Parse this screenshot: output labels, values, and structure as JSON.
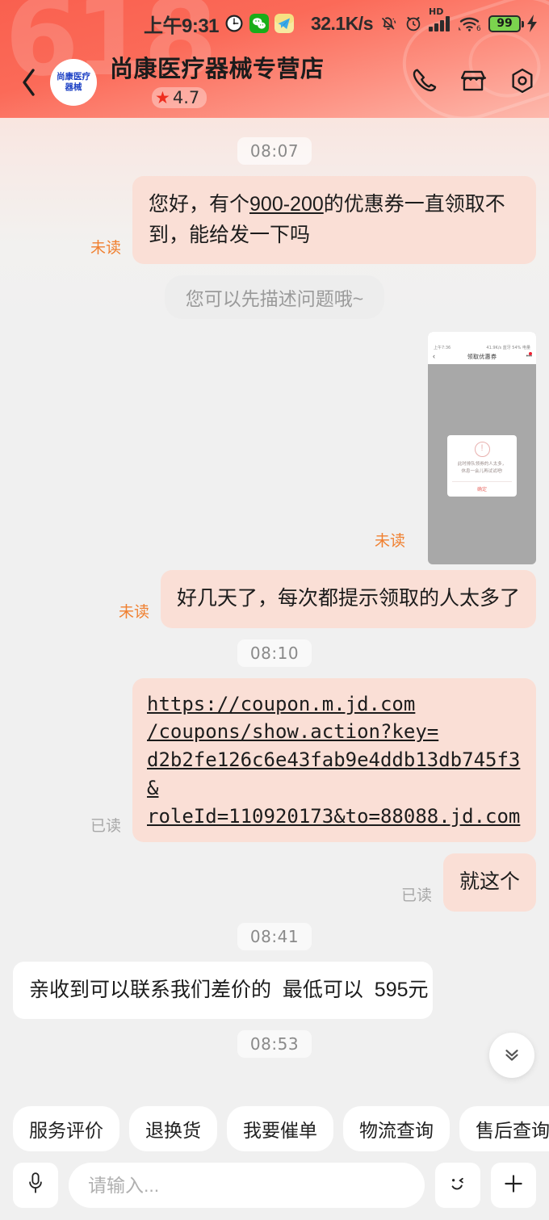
{
  "status_bar": {
    "time": "上午9:31",
    "network_speed": "32.1K/s",
    "battery_level": "99",
    "hd_label": "HD",
    "wifi_generation": "6",
    "icons": [
      "clock-icon",
      "wechat-icon",
      "telegram-icon",
      "mute-bell-icon",
      "alarm-clock-icon",
      "hd-signal-icon",
      "wifi-icon",
      "battery-icon",
      "charging-bolt-icon"
    ]
  },
  "header": {
    "watermark": "618",
    "back_icon": "back-chevron-icon",
    "avatar_line1": "尚康医疗",
    "avatar_line2": "器械",
    "store_name": "尚康医疗器械专营店",
    "rating": "4.7",
    "star_icon": "star-icon",
    "actions": [
      {
        "name": "phone-call-button",
        "icon": "phone-icon"
      },
      {
        "name": "store-home-button",
        "icon": "storefront-icon"
      },
      {
        "name": "settings-button",
        "icon": "hex-settings-icon"
      }
    ],
    "accent_color": "#f9604f",
    "star_color": "#ef2d1f"
  },
  "chat": {
    "messages": [
      {
        "kind": "timestamp",
        "text": "08:07"
      },
      {
        "kind": "text",
        "side": "out",
        "status": "未读",
        "status_kind": "unread",
        "text": "您好，有个900-200的优惠券一直领取不到，能给发一下吗",
        "underline_part": "900-200"
      },
      {
        "kind": "hint",
        "text": "您可以先描述问题哦~"
      },
      {
        "kind": "image",
        "side": "out",
        "status": "未读",
        "status_kind": "unread",
        "screenshot": {
          "status_time": "上午7:36",
          "status_right": "41.9K/s 蓝牙 54% 电量",
          "title": "领取优惠券",
          "back_icon": "back-chevron-icon",
          "more_icon": "more-dots-icon",
          "dialog_line1": "此时排队领券的人太多，",
          "dialog_line2": "休息一会儿再试试吧!",
          "dialog_button": "确定",
          "dialog_icon": "exclamation-circle-icon"
        }
      },
      {
        "kind": "text",
        "side": "out",
        "status": "未读",
        "status_kind": "unread",
        "text": "好几天了，每次都提示领取的人太多了"
      },
      {
        "kind": "timestamp",
        "text": "08:10"
      },
      {
        "kind": "link",
        "side": "out",
        "status": "已读",
        "status_kind": "read",
        "url_lines": [
          "https://coupon.m.jd.com",
          "/coupons/show.action?key=",
          "d2b2fe126c6e43fab9e4ddb13db745f3&",
          "roleId=110920173&to=88088.jd.com"
        ],
        "url": "https://coupon.m.jd.com/coupons/show.action?key=d2b2fe126c6e43fab9e4ddb13db745f3&roleId=110920173&to=88088.jd.com"
      },
      {
        "kind": "text",
        "side": "out",
        "status": "已读",
        "status_kind": "read",
        "text": "就这个"
      },
      {
        "kind": "timestamp",
        "text": "08:41"
      },
      {
        "kind": "text",
        "side": "in",
        "status": "",
        "status_kind": "none",
        "text": "亲收到可以联系我们差价的  最低可以  595元"
      },
      {
        "kind": "timestamp",
        "text": "08:53"
      }
    ],
    "scroll_bottom_icon": "double-chevron-down-icon"
  },
  "quick_replies": [
    "服务评价",
    "退换货",
    "我要催单",
    "物流查询",
    "售后查询"
  ],
  "input_bar": {
    "mic_icon": "microphone-icon",
    "placeholder": "请输入...",
    "value": "",
    "emoji_icon": "smiley-face-icon",
    "plus_icon": "plus-icon"
  }
}
